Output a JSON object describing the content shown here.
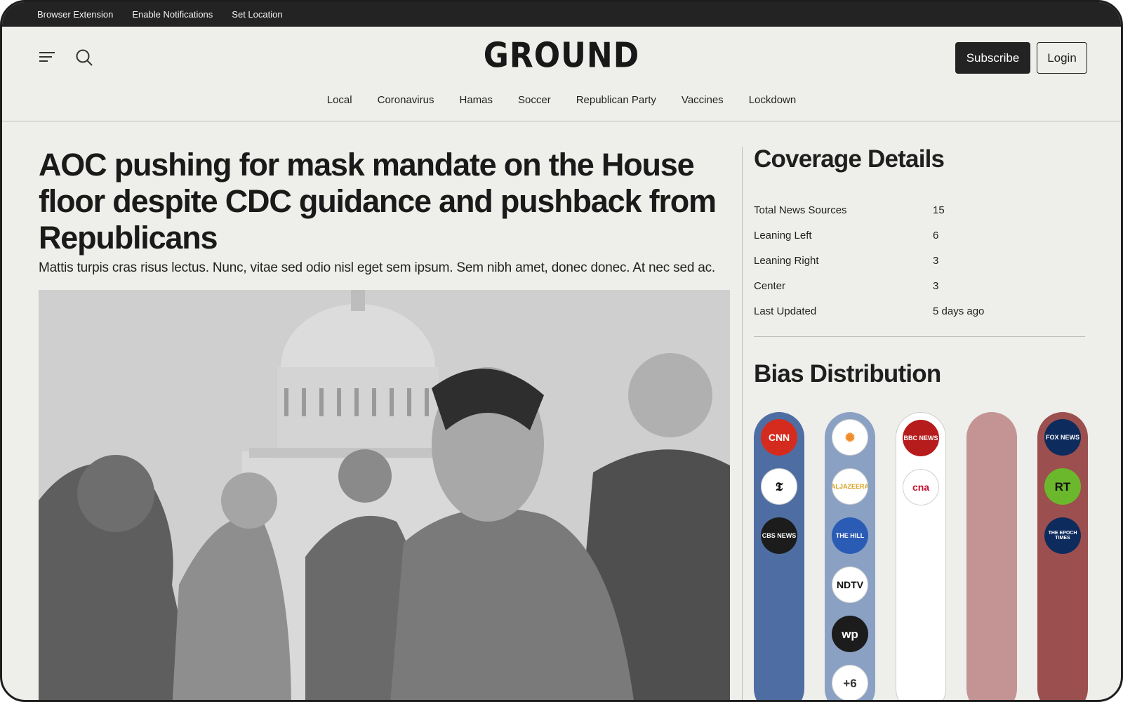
{
  "topbar": {
    "links": [
      "Browser Extension",
      "Enable Notifications",
      "Set Location"
    ]
  },
  "header": {
    "logo": "GROUND",
    "subscribe_label": "Subscribe",
    "login_label": "Login",
    "nav": [
      "Local",
      "Coronavirus",
      "Hamas",
      "Soccer",
      "Republican Party",
      "Vaccines",
      "Lockdown"
    ]
  },
  "article": {
    "headline": "AOC pushing for mask mandate on the House floor despite CDC guidance and pushback from Republicans",
    "summary": "Mattis turpis cras risus lectus. Nunc, vitae sed odio nisl eget sem ipsum. Sem nibh amet, donec donec. At nec sed ac."
  },
  "coverage": {
    "title": "Coverage Details",
    "rows": [
      {
        "label": "Total News Sources",
        "value": "15"
      },
      {
        "label": "Leaning Left",
        "value": "6"
      },
      {
        "label": "Leaning Right",
        "value": "3"
      },
      {
        "label": "Center",
        "value": "3"
      },
      {
        "label": "Last Updated",
        "value": "5 days ago"
      }
    ]
  },
  "bias": {
    "title": "Bias Distribution",
    "columns": [
      {
        "color": "#4e6ea3",
        "sources": [
          {
            "label": "CNN",
            "bg": "#d52b1e",
            "fg": "#ffffff"
          },
          {
            "label": "𝕿",
            "bg": "#ffffff",
            "fg": "#111111"
          },
          {
            "label": "CBS NEWS",
            "bg": "#1c1c1c",
            "fg": "#ffffff"
          }
        ]
      },
      {
        "color": "#8aa1c4",
        "sources": [
          {
            "label": "✺",
            "bg": "#ffffff",
            "fg": "#f08c2a"
          },
          {
            "label": "ALJAZEERA",
            "bg": "#ffffff",
            "fg": "#d8a21c"
          },
          {
            "label": "THE HILL",
            "bg": "#2a5bb5",
            "fg": "#ffffff"
          },
          {
            "label": "NDTV",
            "bg": "#ffffff",
            "fg": "#111111"
          },
          {
            "label": "wp",
            "bg": "#1c1c1c",
            "fg": "#ffffff"
          },
          {
            "label": "+6",
            "bg": "#ffffff",
            "fg": "#333333"
          }
        ]
      },
      {
        "color": "#ffffff",
        "sources": [
          {
            "label": "BBC NEWS",
            "bg": "#b71c1c",
            "fg": "#ffffff"
          },
          {
            "label": "cna",
            "bg": "#ffffff",
            "fg": "#c8102e"
          }
        ]
      },
      {
        "color": "#c49494",
        "sources": []
      },
      {
        "color": "#9c4f4f",
        "sources": [
          {
            "label": "FOX NEWS",
            "bg": "#0d2b5c",
            "fg": "#ffffff"
          },
          {
            "label": "RT",
            "bg": "#6cb82c",
            "fg": "#111111"
          },
          {
            "label": "THE EPOCH TIMES",
            "bg": "#0d2b5c",
            "fg": "#ffffff"
          }
        ]
      }
    ]
  }
}
